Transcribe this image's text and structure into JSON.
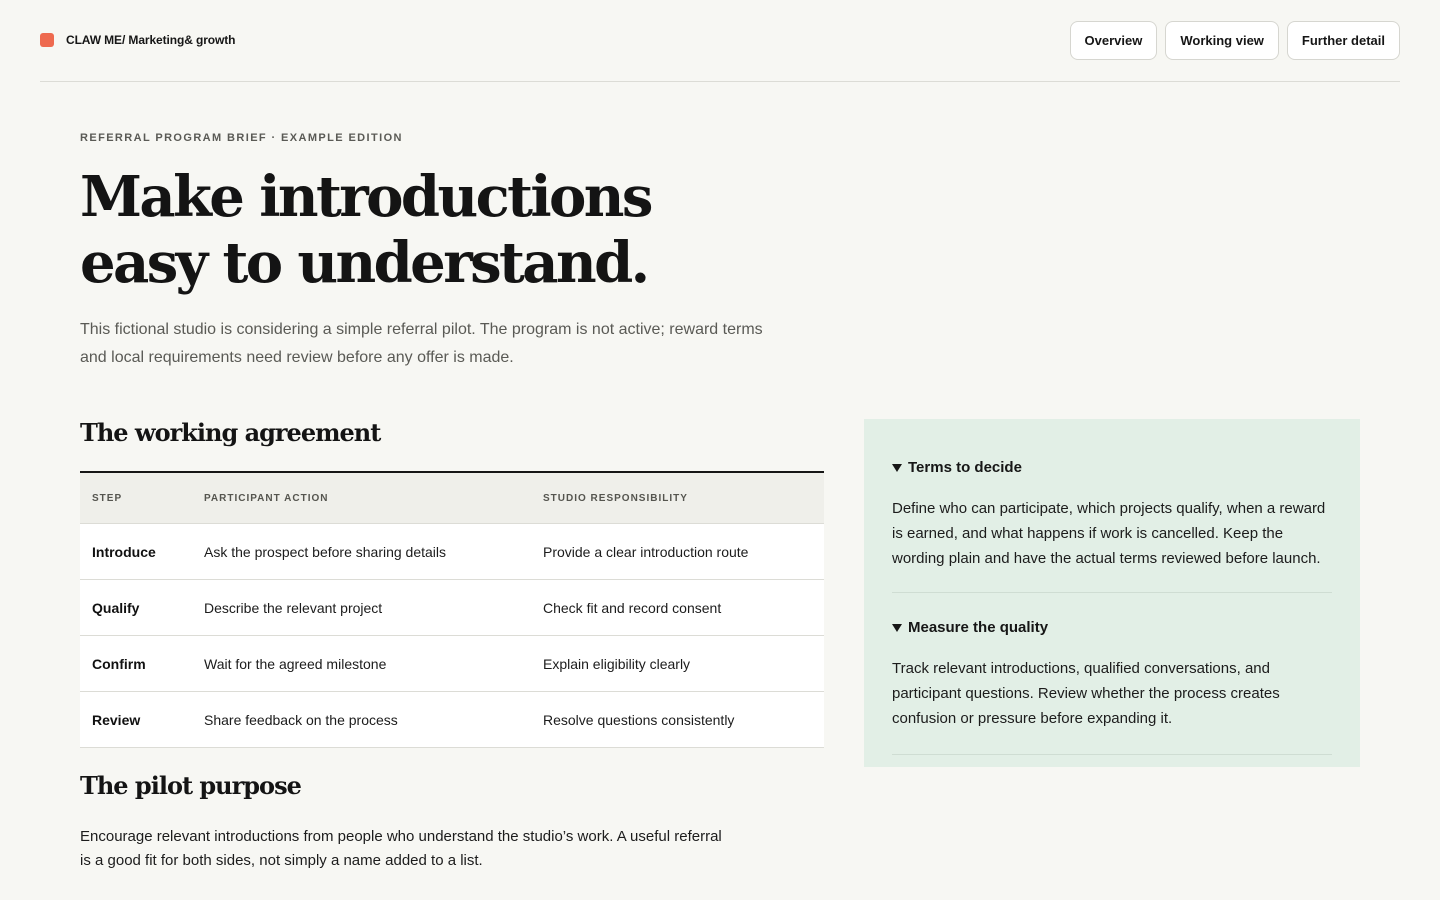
{
  "header": {
    "brand": "CLAW ME/ Marketing& growth",
    "brand_color": "#ee6a4f",
    "nav": [
      {
        "label": "Overview"
      },
      {
        "label": "Working view"
      },
      {
        "label": "Further detail"
      }
    ]
  },
  "hero": {
    "eyebrow": "REFERRAL PROGRAM BRIEF · EXAMPLE EDITION",
    "title_line1": "Make introductions",
    "title_line2": "easy to understand.",
    "lede": "This fictional studio is considering a simple referral pilot. The program is not active; reward terms and local requirements need review before any offer is made."
  },
  "agreement": {
    "heading": "The working agreement",
    "columns": [
      "STEP",
      "PARTICIPANT ACTION",
      "STUDIO RESPONSIBILITY"
    ],
    "rows": [
      {
        "step": "Introduce",
        "action": "Ask the prospect before sharing details",
        "responsibility": "Provide a clear introduction route"
      },
      {
        "step": "Qualify",
        "action": "Describe the relevant project",
        "responsibility": "Check fit and record consent"
      },
      {
        "step": "Confirm",
        "action": "Wait for the agreed milestone",
        "responsibility": "Explain eligibility clearly"
      },
      {
        "step": "Review",
        "action": "Share feedback on the process",
        "responsibility": "Resolve questions consistently"
      }
    ]
  },
  "purpose": {
    "heading": "The pilot purpose",
    "text": "Encourage relevant introductions from people who understand the studio’s work. A useful referral is a good fit for both sides, not simply a name added to a list."
  },
  "side": {
    "panel_color": "#e2efe6",
    "items": [
      {
        "title": "Terms to decide",
        "icon": "triangle-down-icon",
        "expanded": true,
        "body": "Define who can participate, which projects qualify, when a reward is earned, and what happens if work is cancelled. Keep the wording plain and have the actual terms reviewed before launch."
      },
      {
        "title": "Measure the quality",
        "icon": "triangle-down-icon",
        "expanded": true,
        "body": "Track relevant introductions, qualified conversations, and participant questions. Review whether the process creates confusion or pressure before expanding it."
      }
    ]
  }
}
